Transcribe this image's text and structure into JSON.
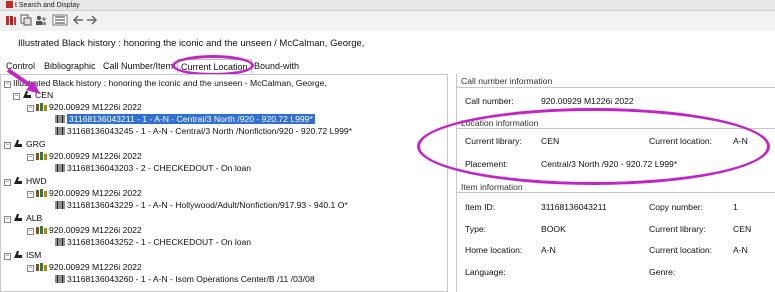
{
  "window": {
    "title": "t Search and Display"
  },
  "header": {
    "title": "Illustrated Black history : honoring the iconic and the unseen / McCalman, George,"
  },
  "tabs": [
    {
      "label": "Control"
    },
    {
      "label": "Bibliographic"
    },
    {
      "label": "Call Number/Item"
    },
    {
      "label": "Current Location"
    },
    {
      "label": "Bound-with"
    }
  ],
  "tree": {
    "root": "Illustrated Black history : honoring the iconic and the unseen - McCalman, George,",
    "libraries": [
      {
        "code": "CEN",
        "callnum": "920.00929 M1226i 2022",
        "items": [
          {
            "text": "31168136043211 - 1 - A-N - Central/3 North /920 - 920.72 L999*",
            "selected": true
          },
          {
            "text": "31168136043245 - 1 - A-N - Central/3 North /Nonfiction/920 - 920.72 L999*",
            "selected": false
          }
        ]
      },
      {
        "code": "GRG",
        "callnum": "920.00929 M1226i 2022",
        "items": [
          {
            "text": "31168136043203 - 2 - CHECKEDOUT - On loan",
            "selected": false
          }
        ]
      },
      {
        "code": "HWD",
        "callnum": "920.00929 M1226i 2022",
        "items": [
          {
            "text": "31168136043229 - 1 - A-N - Hollywood/Adult/Nonfiction/917.93 - 940.1 O*",
            "selected": false
          }
        ]
      },
      {
        "code": "ALB",
        "callnum": "920.00929 M1226i 2022",
        "items": [
          {
            "text": "31168136043252 - 1 - CHECKEDOUT - On loan",
            "selected": false
          }
        ]
      },
      {
        "code": "ISM",
        "callnum": "920.00929 M1226i 2022",
        "items": [
          {
            "text": "31168136043260 - 1 - A-N - Isom Operations Center/B /11 /03/08",
            "selected": false
          }
        ]
      }
    ]
  },
  "callnumber_info": {
    "title": "Call number information",
    "label": "Call number:",
    "value": "920.00929 M1226i 2022"
  },
  "location_info": {
    "title": "Location information",
    "current_library_label": "Current library:",
    "current_library": "CEN",
    "current_location_label": "Current location:",
    "current_location": "A-N",
    "placement_label": "Placement:",
    "placement": "Central/3 North /920 - 920.72 L999*"
  },
  "item_info": {
    "title": "Item information",
    "item_id_label": "Item ID:",
    "item_id": "31168136043211",
    "copy_number_label": "Copy number:",
    "copy_number": "1",
    "type_label": "Type:",
    "type": "BOOK",
    "current_library_label": "Current library:",
    "current_library": "CEN",
    "home_location_label": "Home location:",
    "home_location": "A-N",
    "current_location_label": "Current location:",
    "current_location": "A-N",
    "language_label": "Language:",
    "genre_label": "Genre:"
  },
  "annotation_color": "#c026c6",
  "selection_color": "#2f6fd6"
}
